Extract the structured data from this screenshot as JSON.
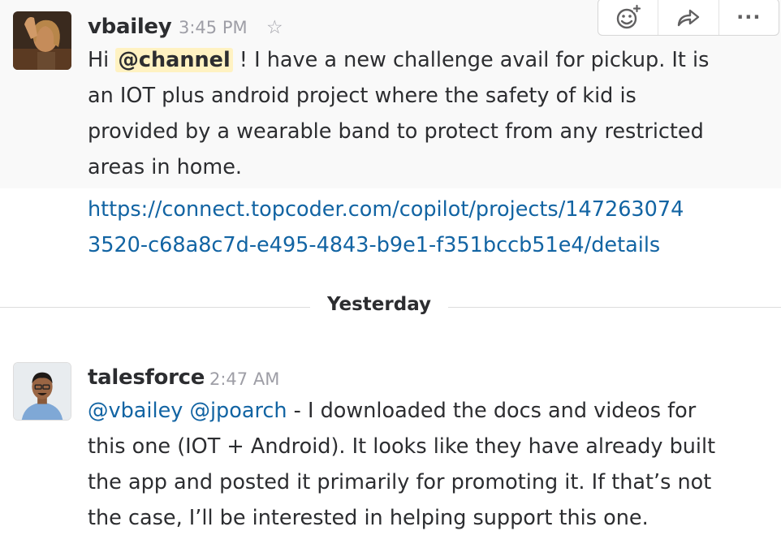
{
  "messages": [
    {
      "sender": "vbailey",
      "time": "3:45 PM",
      "greeting": "Hi ",
      "mention": "@channel",
      "text_after_mention": " !  I have a new challenge avail for pickup.  It is",
      "text_rest": "an IOT plus android project where the safety of kid is\nprovided by a wearable band to protect from any restricted\nareas in home.",
      "link": "https://connect.topcoder.com/copilot/projects/147263074\n3520-c68a8c7d-e495-4843-b9e1-f351bccb51e4/details"
    },
    {
      "sender": "talesforce",
      "time": "2:47 AM",
      "mention_1": "@vbailey",
      "mention_2": "@jpoarch",
      "text_after_mentions": "  - I downloaded the docs and videos for",
      "text_rest": "this one (IOT + Android). It looks like they have already built\nthe app and posted it primarily for promoting it. If that’s not\nthe case, I’ll be interested in helping support this one."
    }
  ],
  "divider": {
    "label": "Yesterday"
  },
  "message_actions": {
    "icons": [
      "add-reaction-icon",
      "share-icon",
      "more-actions-icon"
    ],
    "more_label": "···"
  },
  "colors": {
    "link": "#1264a3",
    "mention_highlight": "#fff2c2",
    "hover_background": "#f9f9f9",
    "timestamp": "#9e9ea6"
  }
}
